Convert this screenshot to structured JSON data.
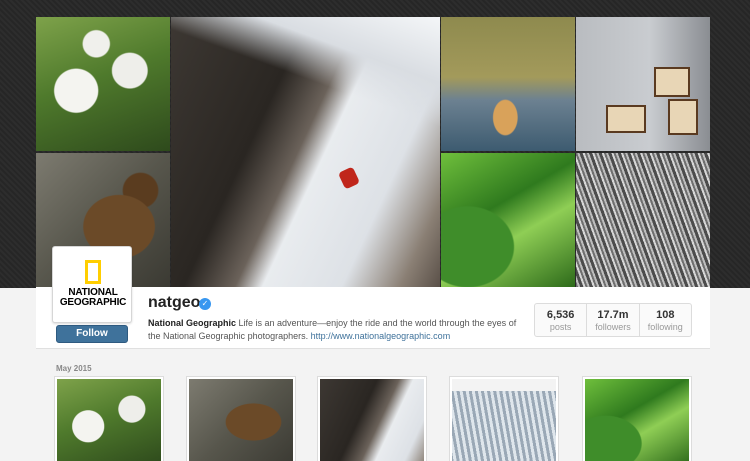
{
  "profile": {
    "logo_lines": [
      "NATIONAL",
      "GEOGRAPHIC"
    ],
    "username": "natgeo",
    "verified": true,
    "follow_label": "Follow",
    "bio_name": "National Geographic",
    "bio_text": " Life is an adventure—enjoy the ride and the world through the eyes of the National Geographic photographers. ",
    "bio_link": "http://www.nationalgeographic.com"
  },
  "stats": [
    {
      "value": "6,536",
      "label": "posts"
    },
    {
      "value": "17.7m",
      "label": "followers"
    },
    {
      "value": "108",
      "label": "following"
    }
  ],
  "feed": {
    "month_label": "May 2015"
  },
  "colors": {
    "follow_button": "#3f729b",
    "verified_badge": "#3897f0",
    "logo_frame": "#ffce00",
    "link": "#3f729b"
  }
}
